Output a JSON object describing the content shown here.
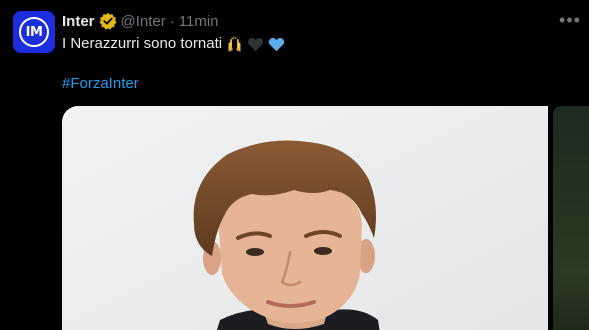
{
  "tweet": {
    "account": {
      "display_name": "Inter",
      "handle": "@Inter",
      "separator": "·",
      "time": "11min",
      "avatar_text": "IM",
      "verified": true
    },
    "text": "I Nerazzurri sono tornati",
    "emojis": [
      "raising-hands-emoji",
      "black-heart-emoji",
      "blue-heart-emoji"
    ],
    "hashtag": "#ForzaInter",
    "media_count_visible": 2
  },
  "colors": {
    "background": "#000000",
    "text_primary": "#e7e9ea",
    "text_secondary": "#71767b",
    "link": "#1d9bf0",
    "verified_badge": "#e2b719",
    "avatar_bg": "#1c2edb"
  }
}
